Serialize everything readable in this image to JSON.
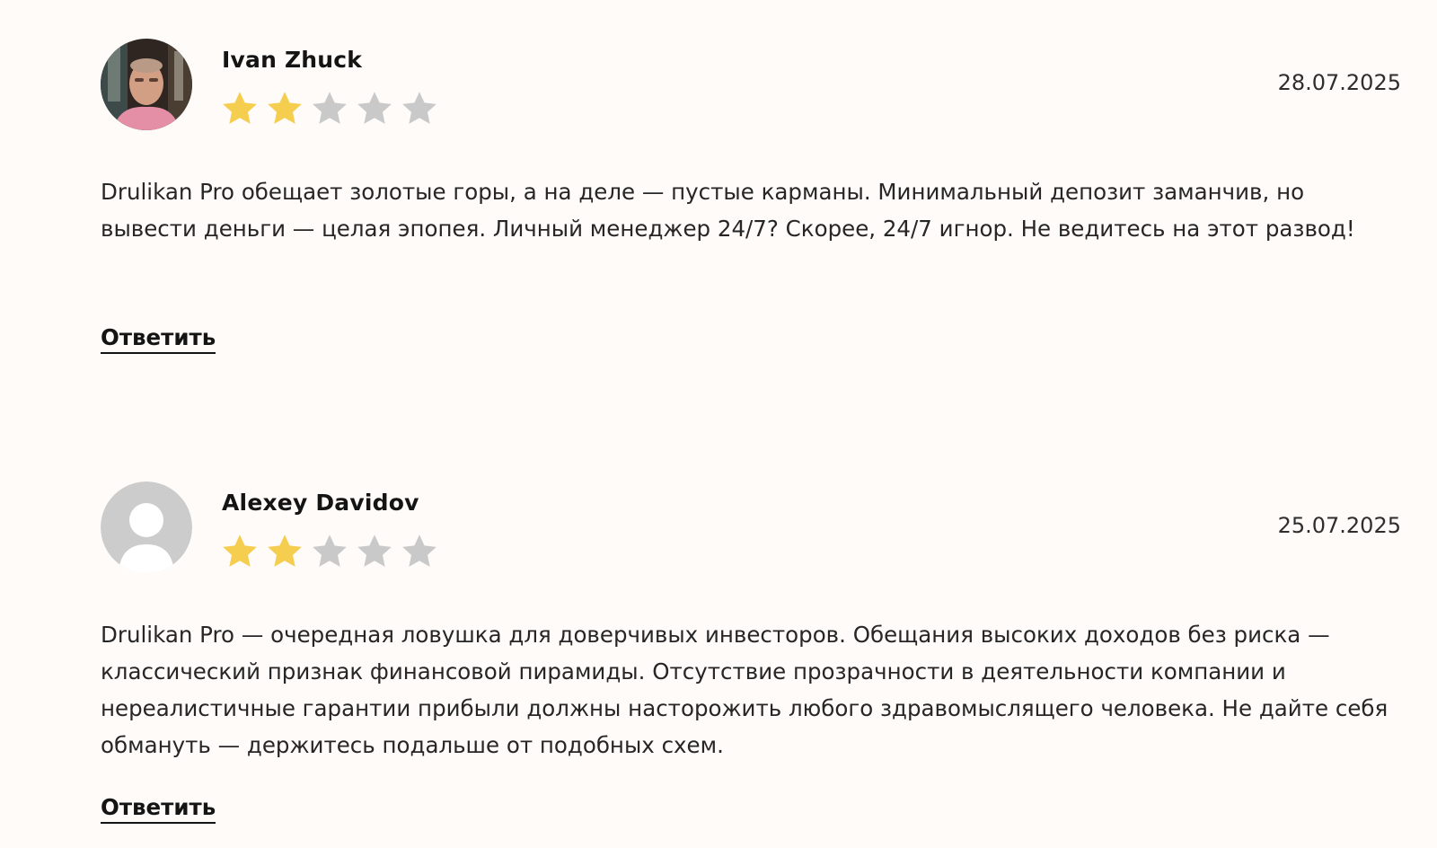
{
  "reviews": [
    {
      "author": "Ivan Zhuck",
      "date": "28.07.2025",
      "rating": 2,
      "rating_max": 5,
      "avatar": "user-photo",
      "text": "Drulikan Pro обещает золотые горы, а на деле — пустые карманы. Минимальный депозит заманчив, но вывести деньги — целая эпопея. Личный менеджер 24/7? Скорее, 24/7 игнор. Не ведитесь на этот развод!",
      "reply_label": "Ответить"
    },
    {
      "author": "Alexey Davidov",
      "date": "25.07.2025",
      "rating": 2,
      "rating_max": 5,
      "avatar": "default-user-icon",
      "text": "Drulikan Pro — очередная ловушка для доверчивых инвесторов. Обещания высоких доходов без риска — классический признак финансовой пирамиды. Отсутствие прозрачности в деятельности компании и нереалистичные гарантии прибыли должны насторожить любого здравомыслящего человека. Не дайте себя обмануть — держитесь подальше от подобных схем.",
      "reply_label": "Ответить"
    }
  ],
  "colors": {
    "background": "#fefbf8",
    "star_filled": "#f5cd4f",
    "star_empty": "#c9c9c9",
    "avatar_placeholder": "#cccccc"
  }
}
